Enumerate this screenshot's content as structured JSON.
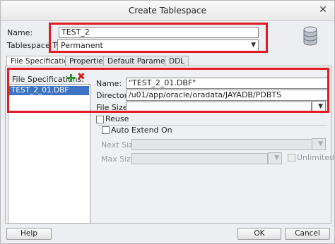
{
  "window": {
    "title": "Create Tablespace"
  },
  "form": {
    "name_label": "Name:",
    "name_value": "TEST_2",
    "type_label": "Tablespace Type:",
    "type_value": "Permanent"
  },
  "tabs": [
    {
      "label": "File Specifications"
    },
    {
      "label": "Properties"
    },
    {
      "label": "Default Parameters"
    },
    {
      "label": "DDL"
    }
  ],
  "file_specs": {
    "header": "File Specifications:",
    "items": [
      "TEST_2_01.DBF"
    ]
  },
  "details": {
    "name_label": "Name:",
    "name_value": "\"TEST_2_01.DBF\"",
    "directory_label": "Directory:",
    "directory_value": "/u01/app/oracle/oradata/JAYADB/PDBTS",
    "file_size_label": "File Size:",
    "file_size_value": "",
    "reuse_label": "Reuse",
    "auto_extend_label": "Auto Extend On",
    "next_size_label": "Next Size:",
    "max_size_label": "Max Size:",
    "unlimited_label": "Unlimited"
  },
  "footer": {
    "help": "Help",
    "ok": "OK",
    "cancel": "Cancel"
  },
  "colors": {
    "highlight": "#e01b24",
    "selection": "#3d74c3"
  },
  "icons": [
    "close-icon",
    "database-icon",
    "add-icon",
    "remove-icon",
    "chevron-down-icon"
  ]
}
